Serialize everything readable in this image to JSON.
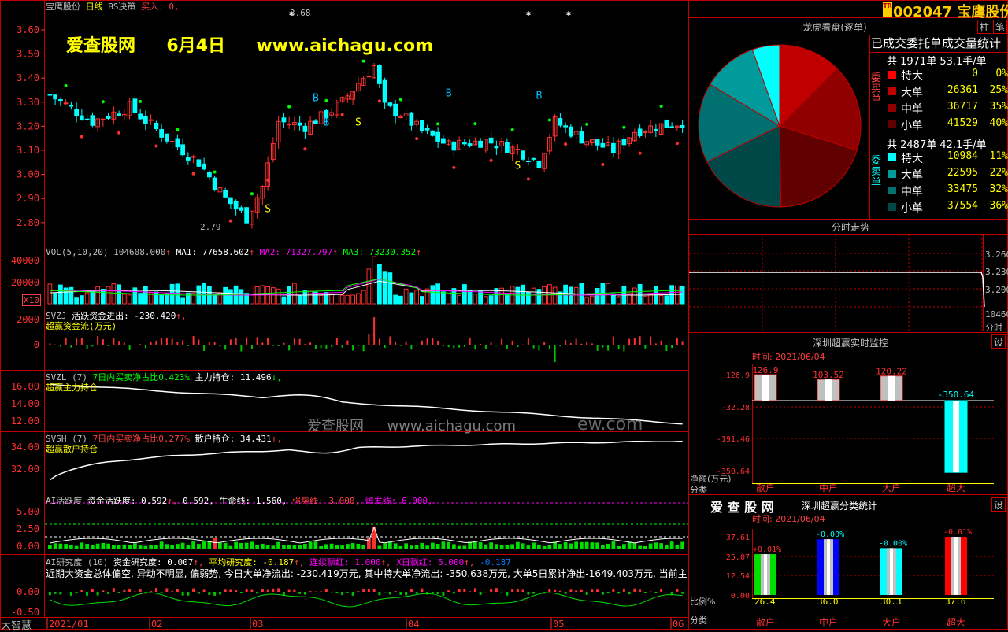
{
  "header": {
    "stock_name": "宝鹰股份",
    "period": "日线",
    "strategy": "BS决策",
    "buy_text": "买入: 0,",
    "watermark_site": "爱查股网",
    "watermark_date": "6月4日",
    "watermark_url": "www.aichagu.com",
    "watermark_mid": "爱查股网",
    "watermark_mid_url": "www.aichagu.com",
    "watermark_mid_tail": "ew.com",
    "footer_logo": "大智慧"
  },
  "price_panel": {
    "y_ticks": [
      "3.60",
      "3.50",
      "3.40",
      "3.30",
      "3.20",
      "3.10",
      "3.00",
      "2.90",
      "2.80"
    ],
    "high_label": "3.68",
    "low_label": "2.79",
    "signals": [
      "S",
      "B",
      "S",
      "B",
      "S",
      "B",
      "B"
    ]
  },
  "vol_panel": {
    "title": "VOL(5,10,20)",
    "vol_value": "104608.000",
    "ma1": "MA1: 77658.602",
    "ma2": "MA2: 71327.797",
    "ma3": "MA3: 73230.352",
    "y_ticks": [
      "40000",
      "20000"
    ],
    "unit": "X10"
  },
  "svzj_panel": {
    "title": "SVZJ",
    "subtitle": "活跃资金进出: -230.420",
    "label2": "超赢资金流(万元)",
    "y_ticks": [
      "2000",
      "0"
    ]
  },
  "svzl_panel": {
    "title": "SVZL (7)",
    "subtitle": "7日内买卖净占比0.423%",
    "holding": "主力持仓: 11.496",
    "label2": "超赢主力持仓",
    "y_ticks": [
      "16.00",
      "14.00",
      "12.00"
    ]
  },
  "svsh_panel": {
    "title": "SVSH (7)",
    "subtitle": "7日内买卖净占比0.277%",
    "holding": "散户持仓: 34.431",
    "label2": "超赢散户持仓",
    "y_ticks": [
      "34.00",
      "32.00"
    ]
  },
  "ai_panel": {
    "title": "AI活跃度",
    "text1": "资金活跃度: 0.592",
    "text2": "0.592,",
    "text3": "生命线: 1.560,",
    "text4": "强势线: 3.000,",
    "text5": "爆发线: 6.000,",
    "y_ticks": [
      "5.00",
      "2.50",
      "0.00"
    ]
  },
  "ai_research": {
    "title": "AI研究度 (10)",
    "text1": "资金研究度: 0.007",
    "text2": "平均研究度: -0.187",
    "text3": "连续飘红: 1.000",
    "text4": "X日飘红: 5.000",
    "text5": "-0.187",
    "summary": "近期大资金总体偏空, 异动不明显, 偏弱势, 今日大单净流出: -230.419万元, 其中特大单净流出: -350.638万元, 大单5日累计净出-1649.403万元, 当前主",
    "y_ticks": [
      "0.00",
      "-0.50"
    ]
  },
  "x_axis": [
    "2021/01",
    "02",
    "03",
    "04",
    "05",
    "06"
  ],
  "right_header": {
    "code": "002047",
    "name": "宝鹰股份",
    "tag": "TR",
    "btn1": "柱",
    "btn2": "笔"
  },
  "dragon_panel": {
    "title": "龙虎看盘(逐单)",
    "stat_title": "已成交委托单成交量统计",
    "buy_total": "共 1971单 53.1手/单",
    "sell_total": "共 2487单 42.1手/单",
    "buy_label": "委买单",
    "sell_label": "委卖单",
    "buy_rows": [
      {
        "name": "特大",
        "value": "0",
        "pct": "0%",
        "color": "#ff0000"
      },
      {
        "name": "大单",
        "value": "26361",
        "pct": "25%",
        "color": "#c00000"
      },
      {
        "name": "中单",
        "value": "36717",
        "pct": "35%",
        "color": "#900000"
      },
      {
        "name": "小单",
        "value": "41529",
        "pct": "40%",
        "color": "#600000"
      }
    ],
    "sell_rows": [
      {
        "name": "特大",
        "value": "10984",
        "pct": "11%",
        "color": "#00ffff"
      },
      {
        "name": "大单",
        "value": "22595",
        "pct": "22%",
        "color": "#009a9a"
      },
      {
        "name": "中单",
        "value": "33475",
        "pct": "32%",
        "color": "#007070"
      },
      {
        "name": "小单",
        "value": "37554",
        "pct": "36%",
        "color": "#004848"
      }
    ]
  },
  "intraday_panel": {
    "title": "分时走势",
    "y_ticks": [
      "3.260",
      "3.230",
      "3.200"
    ],
    "vol_label": "10460",
    "time_label": "分时"
  },
  "monitor_panel": {
    "title": "深圳超赢实时监控",
    "btn": "设",
    "time": "时间: 2021/06/04",
    "y_ticks": [
      "126.9",
      "-32.28",
      "-191.46",
      "-350.64"
    ],
    "bar_values": [
      "126.9",
      "103.52",
      "120.22",
      "-350.64"
    ],
    "y_label": "净额(万元)",
    "x_label": "分类",
    "categories": [
      "散户",
      "中户",
      "大户",
      "超大"
    ]
  },
  "classify_panel": {
    "logo": "爱 查 股 网",
    "title": "深圳超赢分类统计",
    "btn": "设",
    "time": "时间: 2021/06/04",
    "y_ticks": [
      "37.61",
      "25.07",
      "12.54",
      "0.00"
    ],
    "top_labels": [
      "+0.01%",
      "-0.00%",
      "-0.00%",
      "-0.01%"
    ],
    "bottom_values": [
      "26.4",
      "36.0",
      "30.3",
      "37.6"
    ],
    "y_label": "比例%",
    "x_label": "分类",
    "categories": [
      "散户",
      "中户",
      "大户",
      "超大"
    ],
    "colors": [
      "#00e000",
      "#0000ff",
      "#00ffff",
      "#ff0000"
    ]
  }
}
